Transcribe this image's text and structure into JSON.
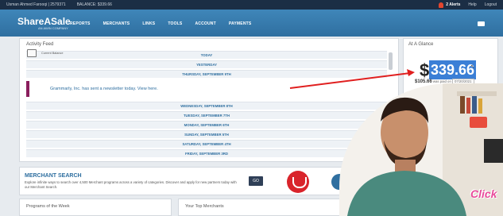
{
  "topbar": {
    "user": "Usman Ahmed Farooqi | 2579371",
    "balance": "BALANCE: $339.66",
    "alerts": "2 Alerts",
    "help": "Help",
    "logout": "Logout"
  },
  "nav": {
    "logo_main": "ShareASale",
    "logo_sub": "AN AWIN COMPANY",
    "links": [
      "REPORTS",
      "MERCHANTS",
      "LINKS",
      "TOOLS",
      "ACCOUNT",
      "PAYMENTS"
    ]
  },
  "feed": {
    "title": "Activity Feed",
    "dates_top": [
      "TODAY",
      "YESTERDAY",
      "THURSDAY, SEPTEMBER 9TH"
    ],
    "message": "Grammarly, Inc. has sent a newsletter today. View here.",
    "dates_bottom": [
      "WEDNESDAY, SEPTEMBER 8TH",
      "TUESDAY, SEPTEMBER 7TH",
      "MONDAY, SEPTEMBER 6TH",
      "SUNDAY, SEPTEMBER 5TH",
      "SATURDAY, SEPTEMBER 4TH",
      "FRIDAY, SEPTEMBER 3RD"
    ]
  },
  "glance": {
    "title": "At A Glance",
    "current_balance_label": "Current Balance",
    "dollar": "$",
    "amount": "339.66",
    "last_paid_amount": "$105.66",
    "last_paid_text": "was paid on",
    "last_paid_date": "07/20/2021"
  },
  "merchant_search": {
    "title": "MERCHANT SEARCH",
    "description": "Explore infinite ways to search over 4,500 Merchant programs across a variety of categories. Discover and apply for new partners today with our Merchant Search.",
    "go": "GO"
  },
  "bottom": {
    "left_title": "Programs of the Week",
    "right_title": "Your Top Merchants"
  },
  "overlay": {
    "click_badge": "Click"
  },
  "colors": {
    "nav_blue": "#3f86b9",
    "link_blue": "#2f6fa0",
    "arrow_red": "#e01f1f",
    "highlight": "#3b7fd6"
  }
}
